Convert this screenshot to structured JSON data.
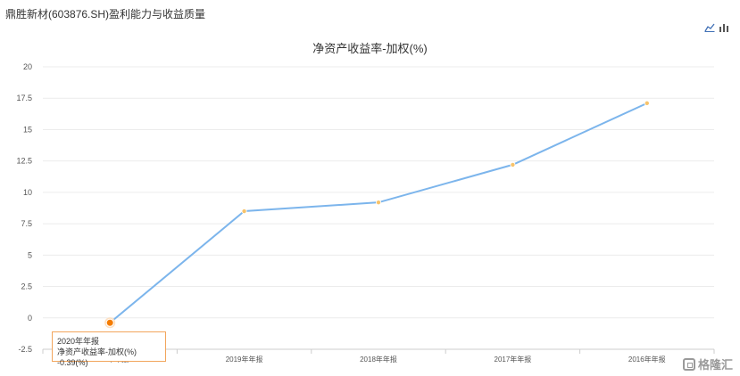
{
  "page": {
    "title": "鼎胜新材(603876.SH)盈利能力与收益质量"
  },
  "toolbar": {
    "line_icon": "line-chart-icon",
    "bar_icon": "bar-chart-icon"
  },
  "chart_data": {
    "type": "line",
    "title": "净资产收益率-加权(%)",
    "categories": [
      "2020年年报",
      "2019年年报",
      "2018年年报",
      "2017年年报",
      "2016年年报"
    ],
    "series": [
      {
        "values": [
          -0.39,
          8.5,
          9.2,
          12.2,
          17.1
        ]
      }
    ],
    "ylim": [
      -2.5,
      20
    ],
    "yticks": [
      "20",
      "17.5",
      "15",
      "12.5",
      "10",
      "7.5",
      "5",
      "2.5",
      "0",
      "-2.5"
    ],
    "ytick_values": [
      20,
      17.5,
      15,
      12.5,
      10,
      7.5,
      5,
      2.5,
      0,
      -2.5
    ],
    "grid": true,
    "colors": {
      "line": "#7cb5ec",
      "marker": "#f7c36b",
      "highlight": "#f57c00",
      "tooltip_border": "#f2a55c"
    }
  },
  "tooltip": {
    "title": "2020年年报",
    "series_label": "净资产收益率-加权(%)",
    "value": "-0.39(%)"
  },
  "watermark": {
    "text": "格隆汇"
  }
}
